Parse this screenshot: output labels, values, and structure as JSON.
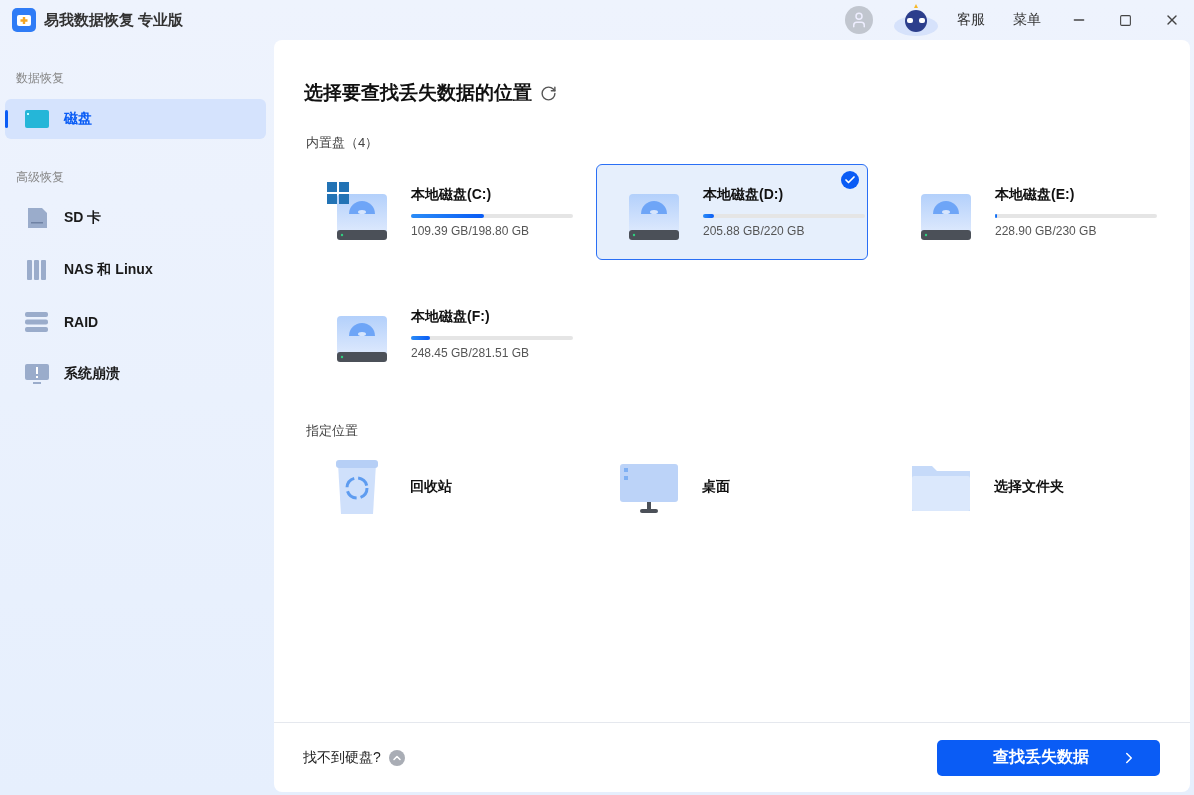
{
  "app": {
    "title": "易我数据恢复 专业版"
  },
  "titlebar": {
    "links": [
      "客服",
      "菜单"
    ]
  },
  "sidebar": {
    "sections": [
      {
        "heading": "数据恢复",
        "items": [
          {
            "kind": "disk",
            "label": "磁盘",
            "selected": true
          }
        ]
      },
      {
        "heading": "高级恢复",
        "items": [
          {
            "kind": "sd",
            "label": "SD 卡",
            "selected": false
          },
          {
            "kind": "nas",
            "label": "NAS 和 Linux",
            "selected": false
          },
          {
            "kind": "raid",
            "label": "RAID",
            "selected": false
          },
          {
            "kind": "crash",
            "label": "系统崩溃",
            "selected": false
          }
        ]
      }
    ]
  },
  "main": {
    "title": "选择要查找丢失数据的位置",
    "drives_heading": "内置盘（4）",
    "drives": [
      {
        "name": "本地磁盘(C:)",
        "size": "109.39 GB/198.80 GB",
        "level": 0.45,
        "system": true,
        "selected": false
      },
      {
        "name": "本地磁盘(D:)",
        "size": "205.88 GB/220 GB",
        "level": 0.065,
        "system": false,
        "selected": true
      },
      {
        "name": "本地磁盘(E:)",
        "size": "228.90 GB/230 GB",
        "level": 0.015,
        "system": false,
        "selected": false
      },
      {
        "name": "本地磁盘(F:)",
        "size": "248.45 GB/281.51 GB",
        "level": 0.12,
        "system": false,
        "selected": false
      }
    ],
    "locations_heading": "指定位置",
    "locations": [
      {
        "kind": "recycle",
        "label": "回收站"
      },
      {
        "kind": "desktop",
        "label": "桌面"
      },
      {
        "kind": "folder",
        "label": "选择文件夹"
      }
    ]
  },
  "footer": {
    "help": "找不到硬盘?",
    "scan_button": "查找丢失数据"
  }
}
